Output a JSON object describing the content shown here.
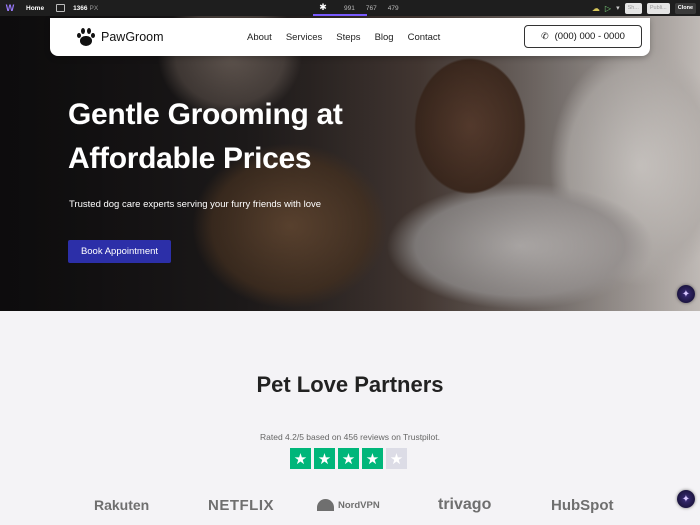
{
  "editor": {
    "home_label": "Home",
    "width_value": "1366",
    "width_unit": "PX",
    "breakpoint_icon": "asterisk-icon",
    "coords": [
      "991",
      "767",
      "479"
    ],
    "share_label": "Sh...",
    "publish_label": "Publi...",
    "clone_label": "Clone"
  },
  "nav": {
    "brand": "PawGroom",
    "links": [
      "About",
      "Services",
      "Steps",
      "Blog",
      "Contact"
    ],
    "phone": "(000) 000 - 0000"
  },
  "hero": {
    "title": "Gentle Grooming at Affordable Prices",
    "subtitle": "Trusted dog care experts serving your furry friends with love",
    "cta": "Book Appointment"
  },
  "partners": {
    "title": "Pet Love Partners",
    "rating_text": "Rated 4.2/5 based on 456 reviews on Trustpilot.",
    "stars_filled": 4,
    "stars_total": 5,
    "brands": [
      "Rakuten",
      "NETFLIX",
      "NordVPN",
      "trivago",
      "HubSpot"
    ]
  },
  "colors": {
    "cta_bg": "#2c2fa8",
    "star_green": "#00b67a",
    "star_empty": "#dcdce6",
    "editor_accent": "#7a5cff"
  }
}
